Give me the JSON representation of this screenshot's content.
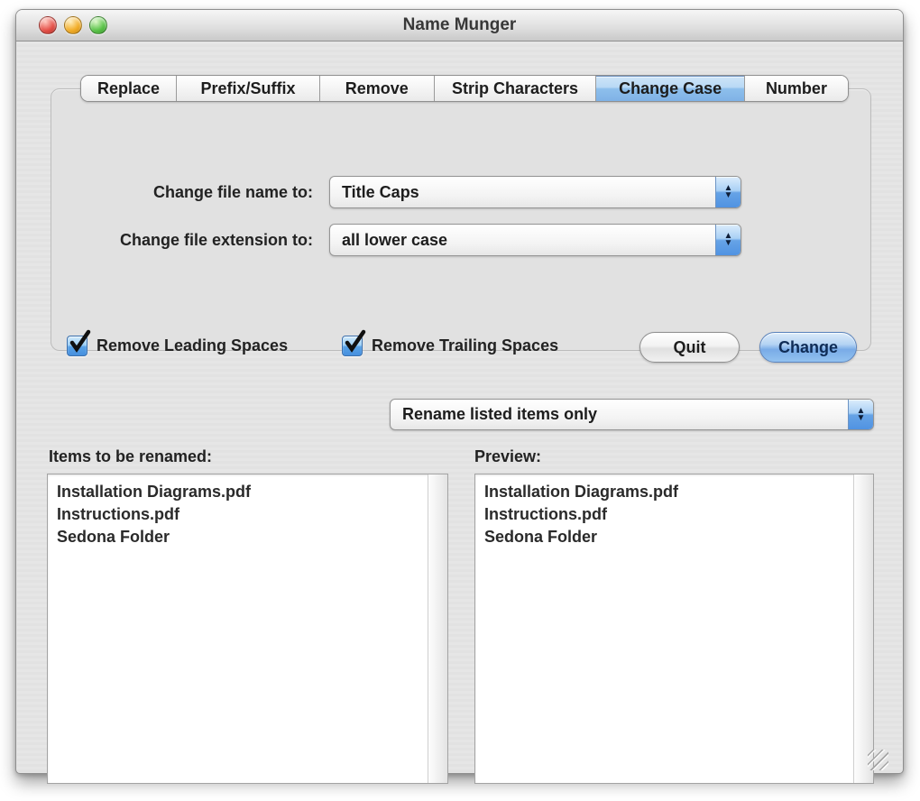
{
  "window": {
    "title": "Name Munger",
    "traffic_lights": {
      "close": "close-button",
      "minimize": "minimize-button",
      "zoom": "zoom-button"
    }
  },
  "tabs": {
    "items": [
      {
        "label": "Replace",
        "selected": false
      },
      {
        "label": "Prefix/Suffix",
        "selected": false
      },
      {
        "label": "Remove",
        "selected": false
      },
      {
        "label": "Strip Characters",
        "selected": false
      },
      {
        "label": "Change Case",
        "selected": true
      },
      {
        "label": "Number",
        "selected": false
      }
    ]
  },
  "panel": {
    "fields": [
      {
        "label": "Change file name to:",
        "value": "Title Caps"
      },
      {
        "label": "Change file extension to:",
        "value": "all lower case"
      }
    ],
    "checkboxes": [
      {
        "label": "Remove Leading Spaces",
        "checked": true
      },
      {
        "label": "Remove Trailing Spaces",
        "checked": true
      }
    ],
    "quit_label": "Quit",
    "change_label": "Change"
  },
  "scope": {
    "value": "Rename listed items only"
  },
  "lists": {
    "source": {
      "label": "Items to be renamed:",
      "items": [
        "Installation Diagrams.pdf",
        "Instructions.pdf",
        "Sedona Folder"
      ]
    },
    "preview": {
      "label": "Preview:",
      "items": [
        "Installation Diagrams.pdf",
        "Instructions.pdf",
        "Sedona Folder"
      ]
    }
  },
  "icons": {
    "stepper_up": "▲",
    "stepper_down": "▼"
  },
  "colors": {
    "selected_tab_blue": "#8dbfec",
    "stepper_blue": "#5093e2",
    "checkbox_blue": "#4690de",
    "default_button_blue": "#79abe7",
    "traffic_red": "#e5524a",
    "traffic_yellow": "#f2ae2a",
    "traffic_green": "#5cc44b",
    "window_gray": "#e3e3e3"
  }
}
